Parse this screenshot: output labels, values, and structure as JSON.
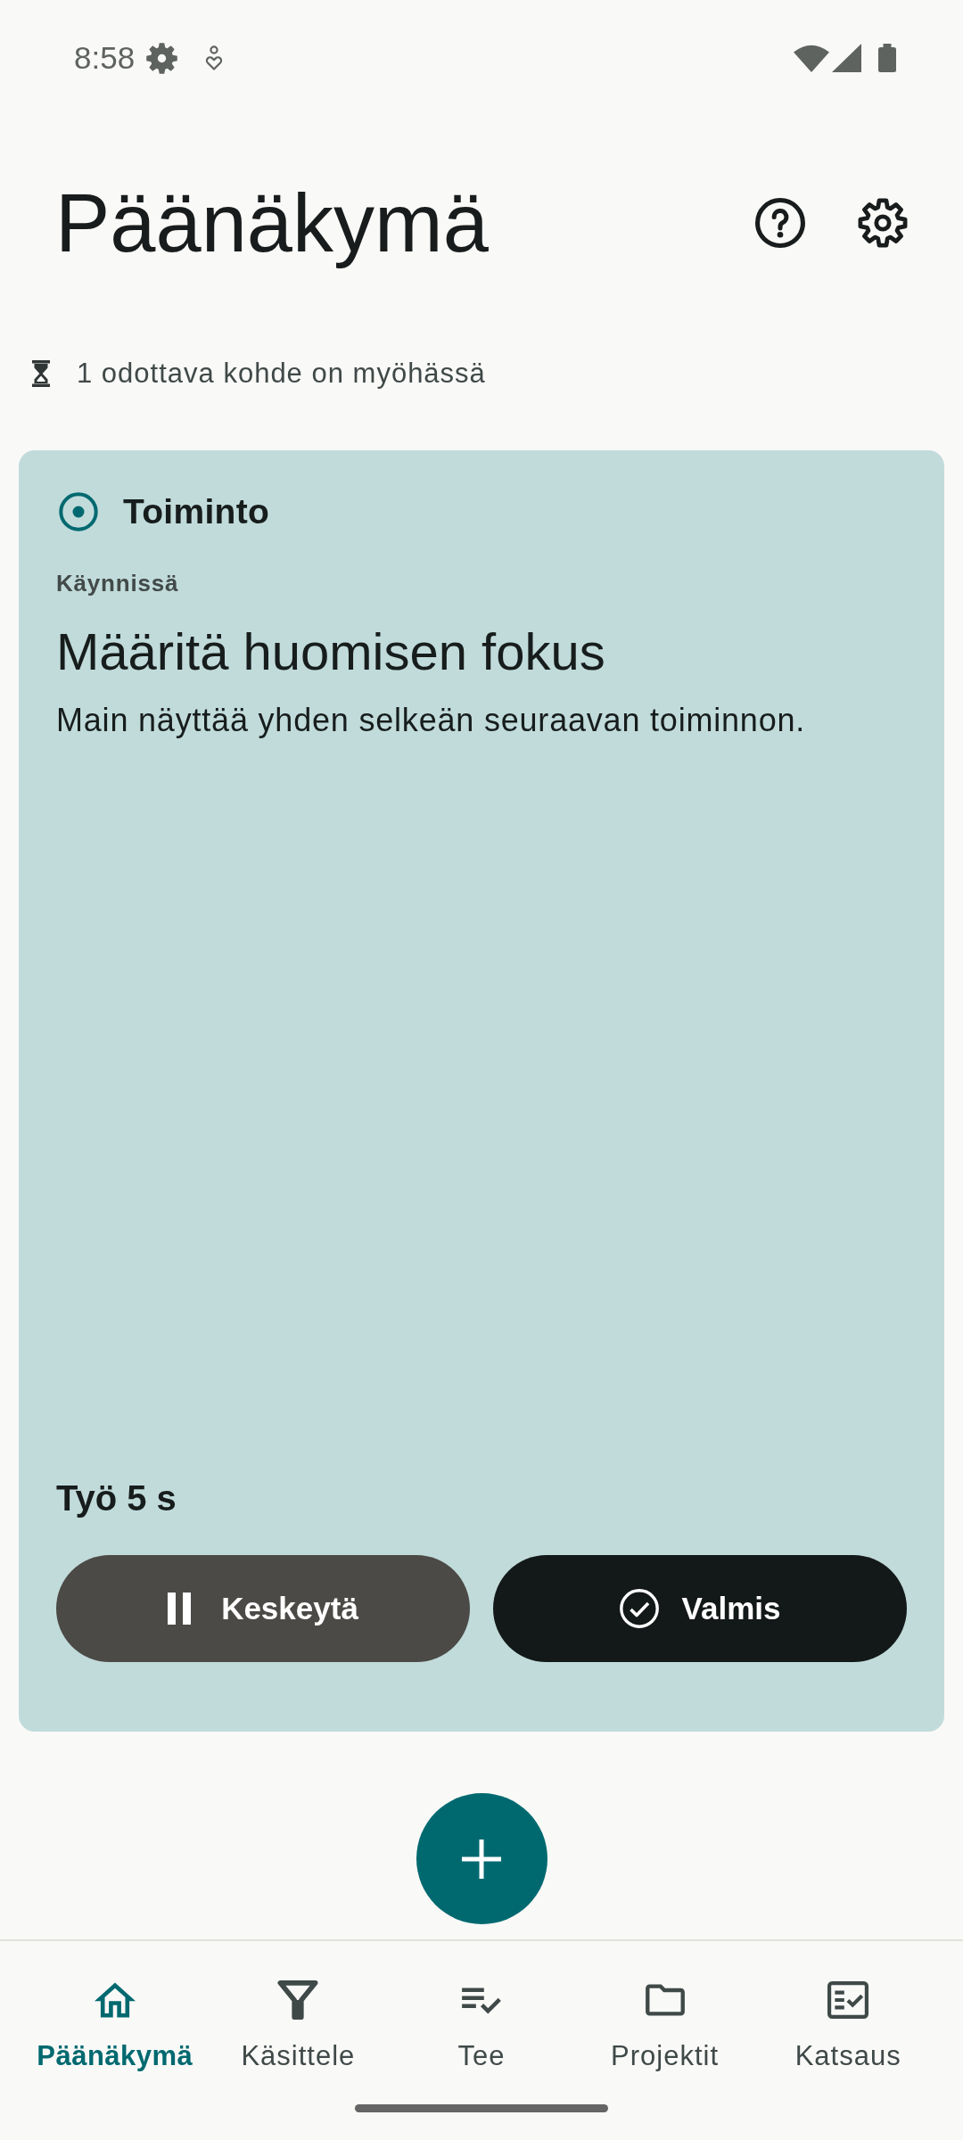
{
  "status_bar": {
    "time": "8:58"
  },
  "header": {
    "title": "Päänäkymä"
  },
  "notice": {
    "text": "1 odottava kohde on myöhässä"
  },
  "card": {
    "heading": "Toiminto",
    "status": "Käynnissä",
    "title": "Määritä huomisen fokus",
    "description": "Main näyttää yhden selkeän seuraavan toiminnon.",
    "timer": "Työ 5 s",
    "buttons": [
      {
        "kind": "pause",
        "label": "Keskeytä"
      },
      {
        "kind": "complete",
        "label": "Valmis"
      }
    ]
  },
  "bottom_nav": [
    {
      "kind": "home",
      "label": "Päänäkymä",
      "selected": true
    },
    {
      "kind": "filter",
      "label": "Käsittele",
      "selected": false
    },
    {
      "kind": "tasks",
      "label": "Tee",
      "selected": false
    },
    {
      "kind": "folder",
      "label": "Projektit",
      "selected": false
    },
    {
      "kind": "review",
      "label": "Katsaus",
      "selected": false
    }
  ]
}
